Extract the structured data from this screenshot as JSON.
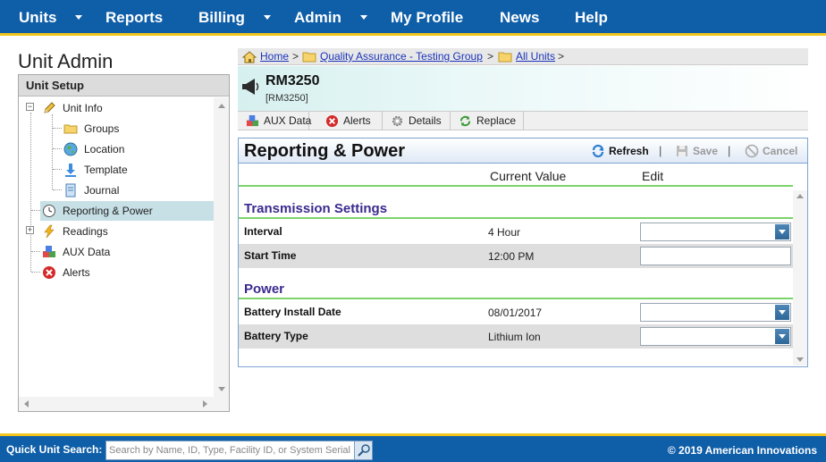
{
  "nav": {
    "items": [
      {
        "label": "Units",
        "has_menu": true
      },
      {
        "label": "Reports",
        "has_menu": false
      },
      {
        "label": "Billing",
        "has_menu": true
      },
      {
        "label": "Admin",
        "has_menu": true
      },
      {
        "label": "My Profile",
        "has_menu": false
      },
      {
        "label": "News",
        "has_menu": false
      },
      {
        "label": "Help",
        "has_menu": false
      }
    ]
  },
  "page_title": "Unit Admin",
  "tree": {
    "header": "Unit Setup",
    "nodes": [
      {
        "label": "Unit Info",
        "icon": "pencil-icon"
      },
      {
        "label": "Groups",
        "icon": "folder-icon"
      },
      {
        "label": "Location",
        "icon": "globe-icon"
      },
      {
        "label": "Template",
        "icon": "download-arrow-icon"
      },
      {
        "label": "Journal",
        "icon": "journal-icon"
      },
      {
        "label": "Reporting & Power",
        "icon": "clock-icon",
        "selected": true
      },
      {
        "label": "Readings",
        "icon": "lightning-icon"
      },
      {
        "label": "AUX Data",
        "icon": "cubes-icon"
      },
      {
        "label": "Alerts",
        "icon": "alert-x-icon"
      }
    ]
  },
  "breadcrumb": {
    "home": "Home",
    "group": "Quality Assurance - Testing Group",
    "all_units": "All Units",
    "separator": ">"
  },
  "unit": {
    "name": "RM3250",
    "id": "[RM3250]"
  },
  "tabs": [
    {
      "label": "AUX Data",
      "icon": "cubes-icon"
    },
    {
      "label": "Alerts",
      "icon": "alert-x-icon"
    },
    {
      "label": "Details",
      "icon": "gear-icon"
    },
    {
      "label": "Replace",
      "icon": "recycle-icon"
    }
  ],
  "panel": {
    "title": "Reporting & Power",
    "refresh": "Refresh",
    "save": "Save",
    "cancel": "Cancel",
    "pipe": "|",
    "col_current": "Current Value",
    "col_edit": "Edit",
    "sections": [
      {
        "title": "Transmission Settings",
        "rows": [
          {
            "label": "Interval",
            "value": "4 Hour",
            "edit": "select"
          },
          {
            "label": "Start Time",
            "value": "12:00 PM",
            "edit": "text"
          }
        ]
      },
      {
        "title": "Power",
        "rows": [
          {
            "label": "Battery Install Date",
            "value": "08/01/2017",
            "edit": "select"
          },
          {
            "label": "Battery Type",
            "value": "Lithium Ion",
            "edit": "select"
          }
        ]
      }
    ]
  },
  "footer": {
    "quick_search_label": "Quick Unit Search:",
    "search_placeholder": "Search by Name, ID, Type, Facility ID, or System Serial",
    "copyright": "© 2019 American Innovations"
  },
  "colors": {
    "nav_blue": "#0f5ea8",
    "accent_yellow": "#f2c51c",
    "section_purple": "#3b2a8f",
    "divider_green": "#7cd36a"
  }
}
